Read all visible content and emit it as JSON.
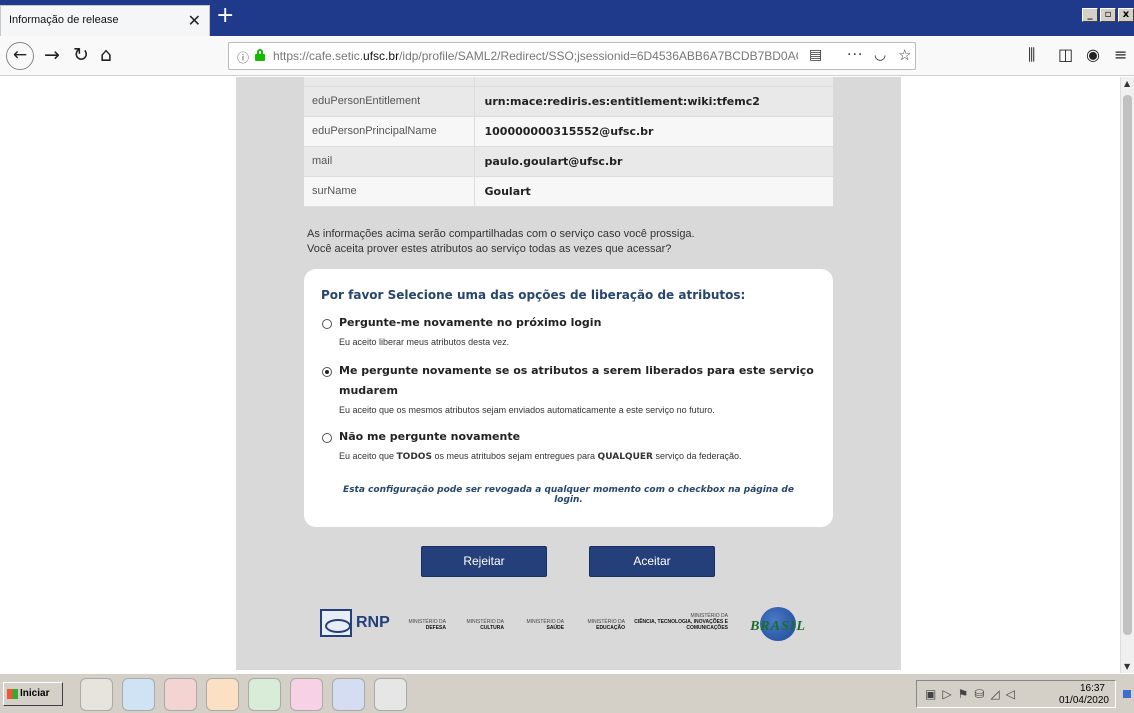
{
  "browser": {
    "tab_title": "Informação de release",
    "url_prefix": "https://cafe.setic.",
    "url_domain": "ufsc.br",
    "url_path": "/idp/profile/SAML2/Redirect/SSO;jsessionid=6D4536ABB6A7BCDB7BD0AC"
  },
  "attributes": [
    {
      "name": "",
      "value": ""
    },
    {
      "name": "eduPersonEntitlement",
      "value": "urn:mace:rediris.es:entitlement:wiki:tfemc2"
    },
    {
      "name": "eduPersonPrincipalName",
      "value": "100000000315552@ufsc.br"
    },
    {
      "name": "mail",
      "value": "paulo.goulart@ufsc.br"
    },
    {
      "name": "surName",
      "value": "Goulart"
    }
  ],
  "info": {
    "line1": "As informações acima serão compartilhadas com o serviço caso você prossiga.",
    "line2": "Você aceita prover estes atributos ao serviço todas as vezes que acessar?"
  },
  "options": {
    "title": "Por favor Selecione uma das opções de liberação de atributos:",
    "items": [
      {
        "label": "Pergunte-me novamente no próximo login",
        "label2": "",
        "desc": "Eu aceito liberar meus atributos desta vez.",
        "checked": false
      },
      {
        "label": "Me pergunte novamente se os atributos a serem liberados para este serviço",
        "label2": "mudarem",
        "desc": "Eu aceito que os mesmos atributos sejam enviados automaticamente a este serviço no futuro.",
        "checked": true
      },
      {
        "label": "Não me pergunte novamente",
        "label2": "",
        "desc_pre": "Eu aceito que ",
        "desc_b1": "TODOS",
        "desc_mid": " os meus atritubos sejam entregues para ",
        "desc_b2": "QUALQUER",
        "desc_post": " serviço da federação.",
        "checked": false
      }
    ],
    "revoke_line1": "Esta configuração pode ser revogada a qualquer momento com o checkbox na página de",
    "revoke_line2": "login."
  },
  "buttons": {
    "reject": "Rejeitar",
    "accept": "Aceitar"
  },
  "logos": {
    "rnp": "RNP",
    "ministries": [
      {
        "top": "MINISTÉRIO DA",
        "name": "DEFESA"
      },
      {
        "top": "MINISTÉRIO DA",
        "name": "CULTURA"
      },
      {
        "top": "MINISTÉRIO DA",
        "name": "SAÚDE"
      },
      {
        "top": "MINISTÉRIO DA",
        "name": "EDUCAÇÃO"
      },
      {
        "top": "MINISTÉRIO DA",
        "name": "CIÊNCIA, TECNOLOGIA, INOVAÇÕES E COMUNICAÇÕES"
      }
    ],
    "brasil": "BRASIL"
  },
  "taskbar": {
    "start": "Iniciar",
    "time": "16:37",
    "date": "01/04/2020"
  }
}
